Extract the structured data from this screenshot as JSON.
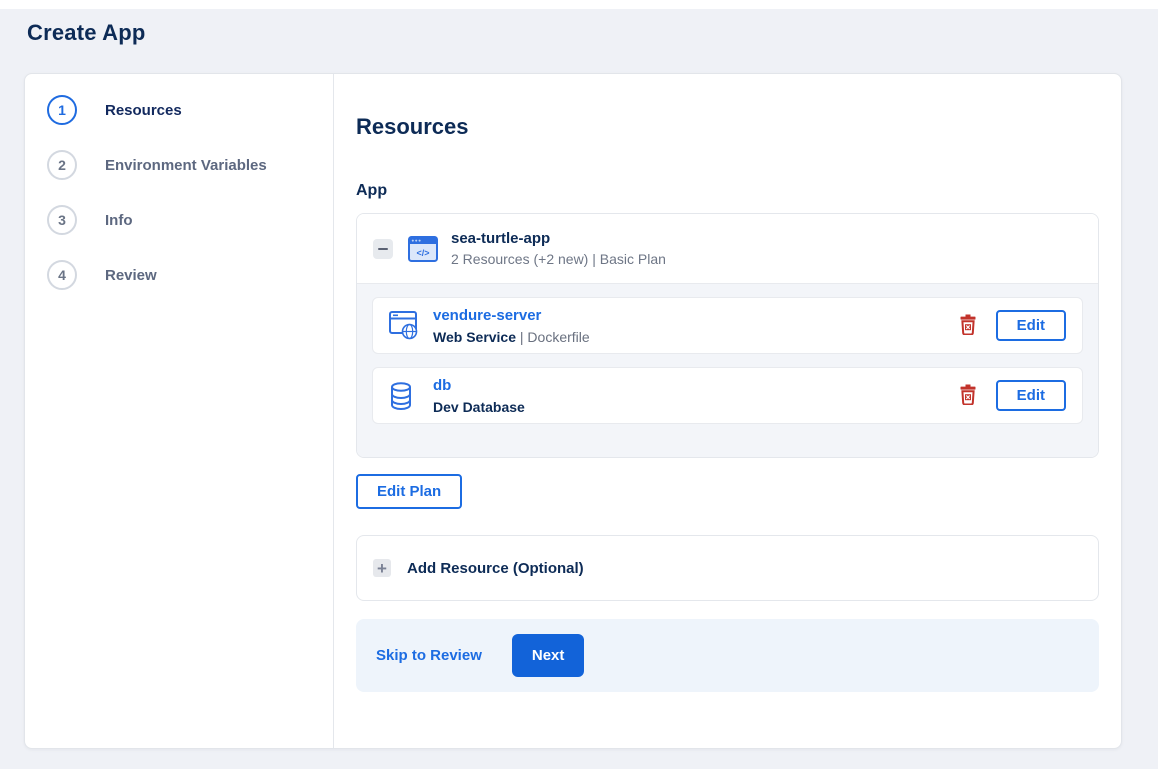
{
  "page": {
    "title": "Create App"
  },
  "stepper": {
    "steps": [
      {
        "number": "1",
        "label": "Resources",
        "state": "active"
      },
      {
        "number": "2",
        "label": "Environment Variables",
        "state": "upcoming"
      },
      {
        "number": "3",
        "label": "Info",
        "state": "upcoming"
      },
      {
        "number": "4",
        "label": "Review",
        "state": "upcoming"
      }
    ]
  },
  "content": {
    "heading": "Resources",
    "section_label": "App",
    "app_group": {
      "name": "sea-turtle-app",
      "summary": "2 Resources (+2 new) | Basic Plan",
      "collapse_icon": "minus-icon",
      "icon": "app-window-code-icon"
    },
    "resources": [
      {
        "name": "vendure-server",
        "type": "Web Service",
        "type_detail": " | Dockerfile",
        "icon": "web-service-globe-icon",
        "delete_icon": "trash-icon",
        "edit_label": "Edit"
      },
      {
        "name": "db",
        "type": "Dev Database",
        "type_detail": "",
        "icon": "database-icon",
        "delete_icon": "trash-icon",
        "edit_label": "Edit"
      }
    ],
    "edit_plan_label": "Edit Plan",
    "add_resource": {
      "label": "Add Resource (Optional)",
      "icon": "plus-icon"
    },
    "footer": {
      "skip_label": "Skip to Review",
      "next_label": "Next"
    }
  },
  "colors": {
    "accent_blue": "#1c6ce2",
    "primary_button_blue": "#1263d9",
    "navy_text": "#0d2b56",
    "muted_text": "#69707f",
    "danger_red": "#c2332b",
    "page_background": "#eff1f6",
    "card_body_background": "#f3f5f9",
    "footer_background": "#eef4fb"
  }
}
